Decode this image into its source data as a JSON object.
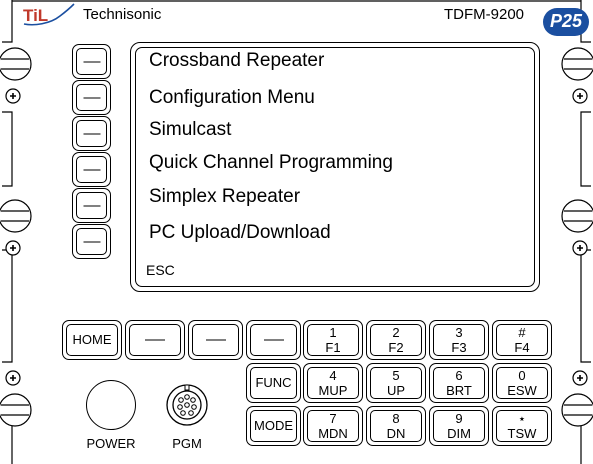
{
  "header": {
    "logo_text": "TiL",
    "brand": "Technisonic",
    "model": "TDFM-9200",
    "badge": "P25"
  },
  "screen": {
    "menu_items": [
      "Crossband Repeater",
      "Configuration Menu",
      "Simulcast",
      "Quick Channel Programming",
      "Simplex Repeater",
      "PC Upload/Download"
    ],
    "esc_label": "ESC"
  },
  "softkeys": {
    "dash": "—"
  },
  "keypad": {
    "home": "HOME",
    "func": "FUNC",
    "mode": "MODE",
    "keys": [
      {
        "top": "1",
        "bottom": "F1"
      },
      {
        "top": "2",
        "bottom": "F2"
      },
      {
        "top": "3",
        "bottom": "F3"
      },
      {
        "top": "#",
        "bottom": "F4"
      },
      {
        "top": "4",
        "bottom": "MUP"
      },
      {
        "top": "5",
        "bottom": "UP"
      },
      {
        "top": "6",
        "bottom": "BRT"
      },
      {
        "top": "0",
        "bottom": "ESW"
      },
      {
        "top": "7",
        "bottom": "MDN"
      },
      {
        "top": "8",
        "bottom": "DN"
      },
      {
        "top": "9",
        "bottom": "DIM"
      },
      {
        "top": "⋆",
        "bottom": "TSW"
      }
    ]
  },
  "controls": {
    "power_label": "POWER",
    "pgm_label": "PGM"
  },
  "colors": {
    "badge_blue": "#1B4FA0",
    "logo_red": "#C0392B",
    "logo_blue": "#1B4FA0"
  }
}
